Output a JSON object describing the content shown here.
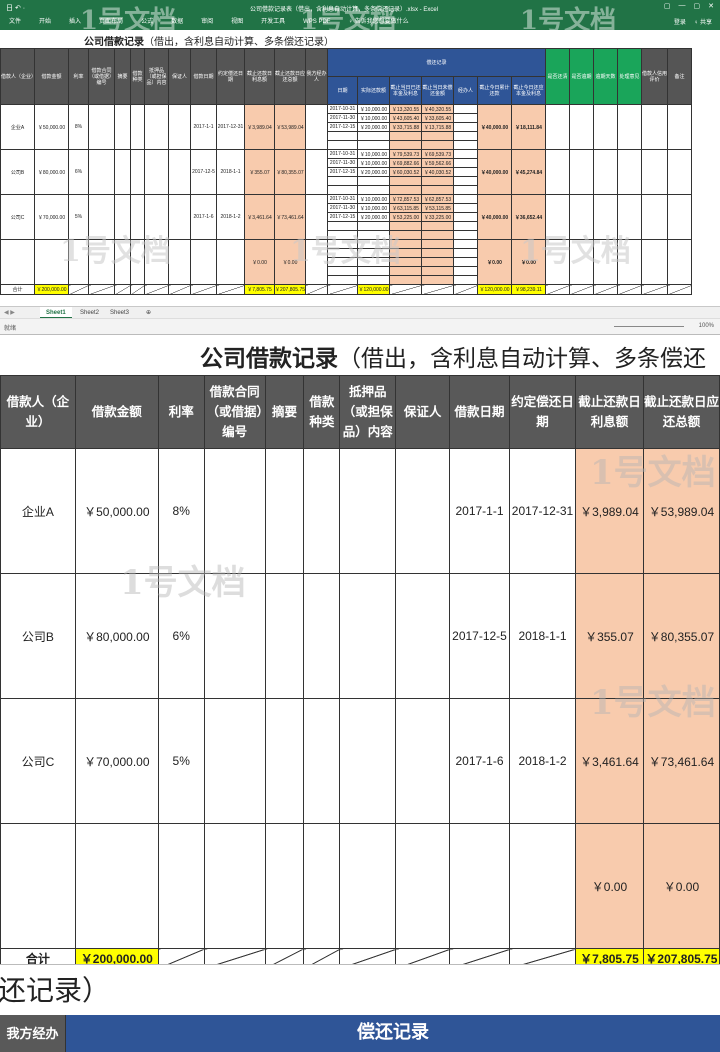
{
  "window": {
    "title": "公司借款记录表（借出，含利息自动计算，多条偿还记录）.xlsx - Excel",
    "quick_access": "日 ↶ ·",
    "menu": [
      "文件",
      "开始",
      "插入",
      "页面布局",
      "公式",
      "数据",
      "审阅",
      "视图",
      "开发工具",
      "WPS PDF",
      "♀ 告诉我您想要做什么"
    ],
    "right": [
      "登录",
      "♀ 共享"
    ],
    "win_controls": [
      "▢",
      "—",
      "▢",
      "✕"
    ]
  },
  "watermark": "1号文档",
  "sheet": {
    "title_bold": "公司借款记录",
    "title_rest": "（借出，含利息自动计算、多条偿还记录）",
    "headers": [
      "借款人（企业）",
      "借款金额",
      "利率",
      "借款合同（或借据）编号",
      "摘要",
      "借款种类",
      "抵押品（或担保品）内容",
      "保证人",
      "借款日期",
      "约定偿还日期",
      "截止还款日利息额",
      "截止还款日应还总额",
      "我方经办人"
    ],
    "repay_header": "偿还记录",
    "repay_cols": [
      "日期",
      "实际还款额",
      "截止当日已还本金及利息",
      "截止当日未偿还金额",
      "经办人",
      "截止今日累计还款",
      "截止今日还应本金及利息",
      "是否还清",
      "是否逾期",
      "逾期天数",
      "处理意见",
      "借款人信用评价",
      "备注"
    ],
    "rows": [
      {
        "borrower": "企业A",
        "amount": "￥50,000.00",
        "rate": "8%",
        "date": "2017-1-1",
        "due": "2017-12-31",
        "interest": "￥3,989.04",
        "total": "￥53,989.04",
        "repayments": [
          [
            "2017-10-31",
            "￥10,000.00",
            "￥13,320.55",
            "￥40,320.55"
          ],
          [
            "2017-11-30",
            "￥10,000.00",
            "￥43,605.40",
            "￥33,605.40"
          ],
          [
            "2017-12-15",
            "￥20,000.00",
            "￥33,715.88",
            "￥13,715.88"
          ]
        ],
        "paid": "￥40,000.00",
        "remain": "￥18,111.84"
      },
      {
        "borrower": "公司B",
        "amount": "￥80,000.00",
        "rate": "6%",
        "date": "2017-12-5",
        "due": "2018-1-1",
        "interest": "￥355.07",
        "total": "￥80,355.07",
        "repayments": [
          [
            "2017-10-31",
            "￥10,000.00",
            "￥79,539.73",
            "￥69,539.73"
          ],
          [
            "2017-11-30",
            "￥10,000.00",
            "￥69,882.66",
            "￥59,562.66"
          ],
          [
            "2017-12-15",
            "￥20,000.00",
            "￥60,030.52",
            "￥40,030.52"
          ]
        ],
        "paid": "￥40,000.00",
        "remain": "￥45,274.84"
      },
      {
        "borrower": "公司C",
        "amount": "￥70,000.00",
        "rate": "5%",
        "date": "2017-1-6",
        "due": "2018-1-2",
        "interest": "￥3,461.64",
        "total": "￥73,461.64",
        "repayments": [
          [
            "2017-10-31",
            "￥10,000.00",
            "￥72,857.53",
            "￥62,857.53"
          ],
          [
            "2017-11-30",
            "￥10,000.00",
            "￥63,115.85",
            "￥53,115.85"
          ],
          [
            "2017-12-15",
            "￥20,000.00",
            "￥53,225.00",
            "￥33,225.00"
          ]
        ],
        "paid": "￥40,000.00",
        "remain": "￥36,652.44"
      },
      {
        "borrower": "",
        "amount": "",
        "rate": "",
        "date": "",
        "due": "",
        "interest": "￥0.00",
        "total": "￥0.00",
        "repayments": [],
        "paid": "￥0.00",
        "remain": "￥0.00"
      }
    ],
    "total_row": {
      "label": "合计",
      "amount": "￥200,000.00",
      "interest": "￥7,805.75",
      "total": "￥207,805.75",
      "repaid": "￥120,000.00",
      "paid": "￥120,000.00",
      "remain": "￥98,239.11"
    }
  },
  "tabs": [
    "Sheet1",
    "Sheet2",
    "Sheet3"
  ],
  "tab_nav": "◀ ▶",
  "add_sheet": "⊕",
  "status": {
    "ready": "就绪",
    "zoom": "100%"
  },
  "zoomed_title_bold": "公司借款记录",
  "zoomed_title_rest": "（借出，含利息自动计算、多条偿还",
  "bottom": {
    "part_title": "还记录）",
    "left_header": "我方经办",
    "right_header": "偿还记录"
  },
  "colors": {
    "excel_green": "#217346",
    "header_gray": "#595959",
    "header_blue": "#2f5597",
    "header_green": "#1aa55a",
    "highlight_orange": "#f8cbad",
    "highlight_yellow": "#ffff00"
  }
}
